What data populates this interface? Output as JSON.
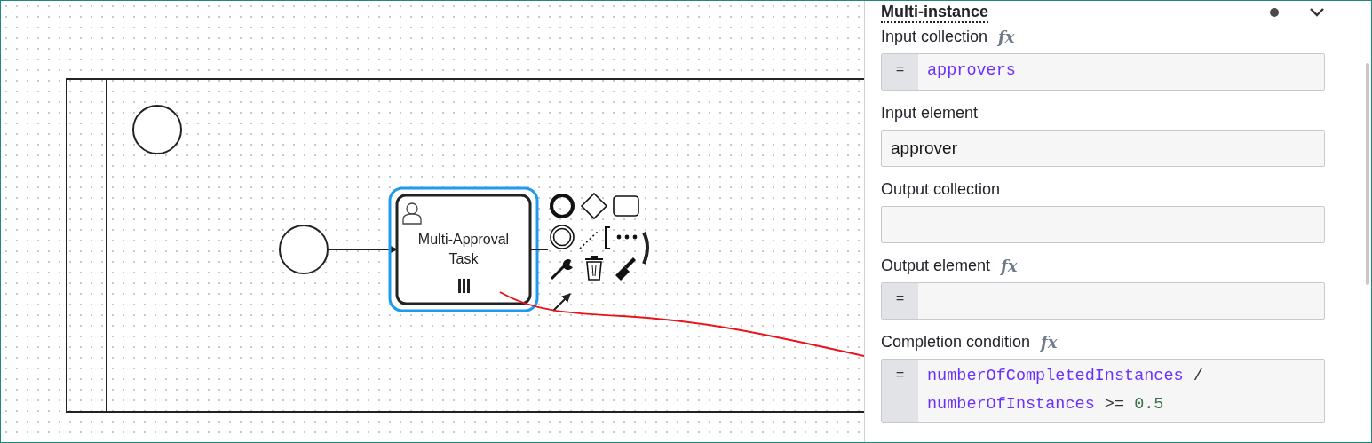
{
  "diagram": {
    "task": {
      "label": [
        "Multi-Approval",
        "Task"
      ],
      "selected": true
    }
  },
  "panel": {
    "group": {
      "title": "Multi-instance",
      "changed": true,
      "expanded": true
    },
    "fields": [
      {
        "label": "Input collection",
        "kind": "feel",
        "toggle": "fx",
        "prefix": "=",
        "tokens": [
          {
            "text": "approvers",
            "kind": "variable"
          }
        ]
      },
      {
        "label": "Input element",
        "kind": "text",
        "value": "approver"
      },
      {
        "label": "Output collection",
        "kind": "text"
      },
      {
        "label": "Output element",
        "kind": "feel",
        "toggle": "fx",
        "prefix": "="
      },
      {
        "label": "Completion condition",
        "kind": "feel",
        "toggle": "fx",
        "prefix": "=",
        "tokens": [
          {
            "text": "numberOfCompletedInstances",
            "kind": "variable"
          },
          {
            "text": " / ",
            "kind": "operator"
          },
          {
            "text": "numberOfInstances",
            "kind": "variable"
          },
          {
            "text": " >= ",
            "kind": "operator"
          },
          {
            "text": "0.5",
            "kind": "number"
          }
        ]
      }
    ]
  }
}
